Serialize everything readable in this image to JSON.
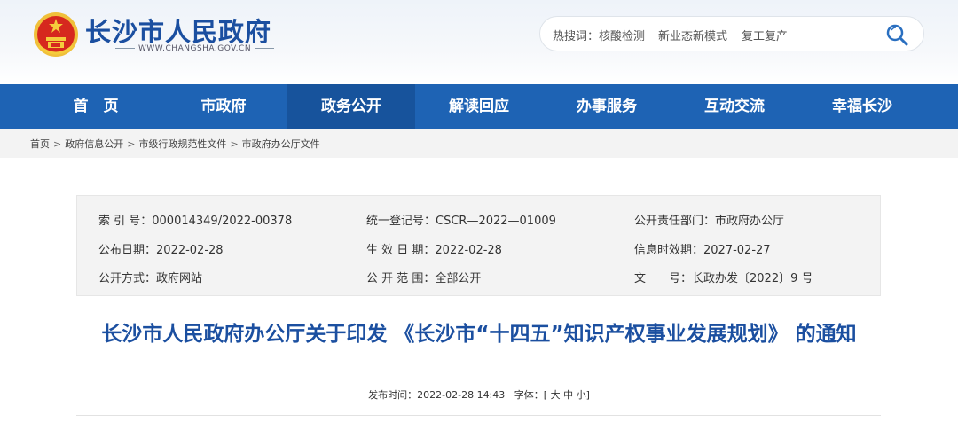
{
  "header": {
    "site_title": "长沙市人民政府",
    "site_domain": "WWW.CHANGSHA.GOV.CN",
    "hot_label": "热搜词：",
    "hot_words": [
      "核酸检测",
      "新业态新模式",
      "复工复产"
    ],
    "brand_color": "#1b4fa0"
  },
  "nav": {
    "items": [
      "首　页",
      "市政府",
      "政务公开",
      "解读回应",
      "办事服务",
      "互动交流",
      "幸福长沙"
    ],
    "active_index": 2,
    "bg_color": "#1e63b4"
  },
  "breadcrumb": [
    "首页",
    "政府信息公开",
    "市级行政规范性文件",
    "市政府办公厅文件"
  ],
  "info": {
    "index_no_label": "索 引 号：",
    "index_no": "000014349/2022-00378",
    "reg_no_label": "统一登记号：",
    "reg_no": "CSCR—2022—01009",
    "dept_label": "公开责任部门：",
    "dept": "市政府办公厅",
    "pub_date_label": "公布日期：",
    "pub_date": "2022-02-28",
    "eff_date_label": "生 效 日 期：",
    "eff_date": "2022-02-28",
    "exp_date_label": "信息时效期：",
    "exp_date": "2027-02-27",
    "method_label": "公开方式：",
    "method": "政府网站",
    "scope_label": "公 开 范 围：",
    "scope": "全部公开",
    "doc_label": "文　　号：",
    "doc": "长政办发〔2022〕9 号"
  },
  "article": {
    "title": "长沙市人民政府办公厅关于印发 《长沙市“十四五”知识产权事业发展规划》 的通知",
    "meta_label": "发布时间：",
    "meta_time": "2022-02-28 14:43",
    "font_label": "字体：",
    "font_open": "[",
    "font_sizes": [
      "大",
      "中",
      "小"
    ],
    "font_close": "]"
  }
}
